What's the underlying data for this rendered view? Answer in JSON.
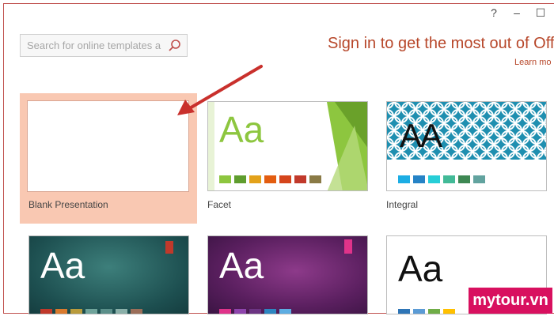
{
  "window": {
    "help_label": "?",
    "minimize_label": "–",
    "maximize_label": "☐"
  },
  "search": {
    "placeholder": "Search for online templates a",
    "icon": "search-icon"
  },
  "signin": {
    "heading": "Sign in to get the most out of Offic",
    "learn_more": "Learn mo"
  },
  "templates": [
    {
      "name": "Blank Presentation",
      "selected": true
    },
    {
      "name": "Facet",
      "sample_text": "Aa"
    },
    {
      "name": "Integral",
      "sample_text": "AA"
    },
    {
      "name": "",
      "sample_text": "Aa"
    },
    {
      "name": "",
      "sample_text": "Aa"
    },
    {
      "name": "",
      "sample_text": "Aa"
    }
  ],
  "colors": {
    "selection": "#f9c8b2",
    "accent": "#b7472a",
    "facet_green": "#8dc63f",
    "watermark": "#d8105f"
  },
  "watermark": {
    "text": "mytour.vn"
  }
}
